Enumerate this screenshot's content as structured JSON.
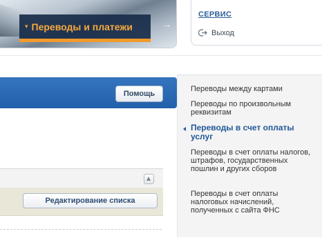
{
  "promo": {
    "label": "Переводы и платежи",
    "caret": "▾",
    "arrow": "→"
  },
  "service_box": {
    "link_label": "СЕРВИС",
    "logout_label": "Выход"
  },
  "toolbar": {
    "help_label": "Помощь"
  },
  "list_panel": {
    "edit_label": "Редактирование списка"
  },
  "side_menu": {
    "items": [
      {
        "label": "Переводы между картами",
        "active": false
      },
      {
        "label": "Переводы по произвольным реквизитам",
        "active": false
      },
      {
        "label": "Переводы в счет оплаты услуг",
        "active": true
      },
      {
        "label": "Переводы в счет оплаты налогов, штрафов, государственных пошлин и других сборов",
        "active": false
      },
      {
        "label": "Переводы в счет оплаты налоговых начислений, полученных с сайта ФНС",
        "active": false
      }
    ]
  },
  "colors": {
    "accent_orange": "#f29a2b",
    "brand_blue": "#2360ab",
    "link_blue": "#2b5d97"
  }
}
